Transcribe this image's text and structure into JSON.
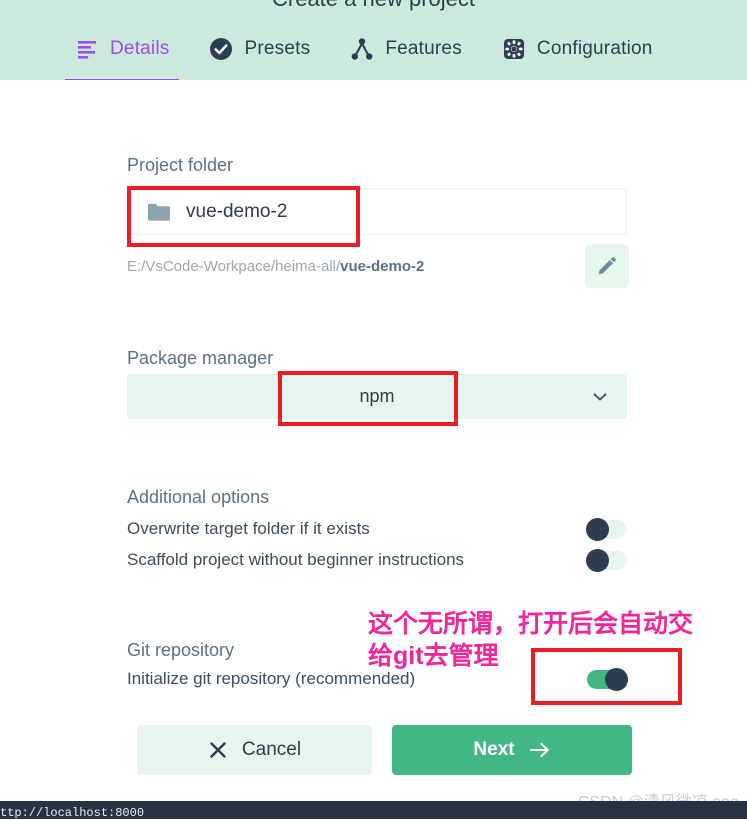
{
  "header": {
    "title": "Create a new project",
    "tabs": [
      {
        "label": "Details",
        "icon": "list-lines-icon",
        "active": true
      },
      {
        "label": "Presets",
        "icon": "check-circle-icon",
        "active": false
      },
      {
        "label": "Features",
        "icon": "sitemap-icon",
        "active": false
      },
      {
        "label": "Configuration",
        "icon": "gear-square-icon",
        "active": false
      }
    ]
  },
  "main": {
    "project_folder": {
      "label": "Project folder",
      "folder_name": "vue-demo-2",
      "folder_icon": "folder-icon",
      "path_prefix": "E:/VsCode-Workpace/heima-all/",
      "path_bold": "vue-demo-2",
      "edit_icon": "pencil-icon"
    },
    "package_manager": {
      "label": "Package manager",
      "value": "npm",
      "caret_icon": "chevron-down-icon"
    },
    "additional_options": {
      "label": "Additional options",
      "items": [
        {
          "label": "Overwrite target folder if it exists",
          "on": false
        },
        {
          "label": "Scaffold project without beginner instructions",
          "on": false
        }
      ]
    },
    "git_repository": {
      "label": "Git repository",
      "item": {
        "label": "Initialize git repository (recommended)",
        "on": true
      }
    }
  },
  "footer": {
    "cancel_label": "Cancel",
    "cancel_icon": "close-x-icon",
    "next_label": "Next",
    "next_icon": "arrow-right-icon"
  },
  "annotations": {
    "note_text": "这个无所谓，打开后会自动交\n给git去管理",
    "note_color": "#f0269a",
    "box_color": "#ee1c25"
  },
  "status_bar": {
    "url": "ttp://localhost:8000",
    "watermark": "CSDN @清风微凉 aaa"
  },
  "colors": {
    "header_band": "#cbeadd",
    "accent_purple": "#a24bf0",
    "accent_green": "#41b883",
    "pale_green": "#e4f6ed",
    "dark_navy": "#2d3e50"
  }
}
